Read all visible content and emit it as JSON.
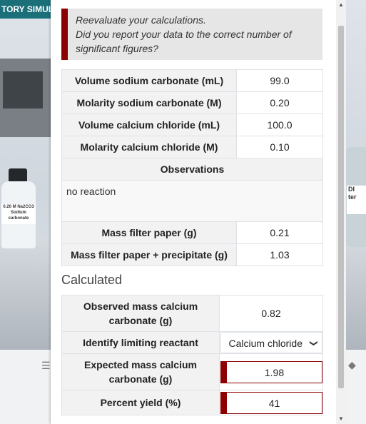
{
  "background": {
    "app_title": "TORY SIMUL",
    "bottle_label": [
      "0.20 M Na2CO3",
      "Sodium carbonate"
    ],
    "bottle2_label": [
      "DI",
      "ter"
    ]
  },
  "alert": {
    "line1": "Reevaluate your calculations.",
    "line2": "Did you report your data to the correct number of",
    "line3": "significant figures?"
  },
  "data_table": {
    "rows": [
      {
        "label": "Volume sodium carbonate (mL)",
        "value": "99.0"
      },
      {
        "label": "Molarity sodium carbonate (M)",
        "value": "0.20"
      },
      {
        "label": "Volume calcium chloride (mL)",
        "value": "100.0"
      },
      {
        "label": "Molarity calcium chloride (M)",
        "value": "0.10"
      }
    ],
    "observations_header": "Observations",
    "observations_text": "no reaction",
    "mass_rows": [
      {
        "label": "Mass filter paper (g)",
        "value": "0.21"
      },
      {
        "label": "Mass filter paper + precipitate (g)",
        "value": "1.03"
      }
    ]
  },
  "calculated": {
    "title": "Calculated",
    "observed_mass": {
      "label": "Observed mass calcium carbonate (g)",
      "value": "0.82"
    },
    "limiting_reactant": {
      "label": "Identify limiting reactant",
      "selected": "Calcium chloride"
    },
    "expected_mass": {
      "label": "Expected mass calcium carbonate (g)",
      "value": "1.98"
    },
    "percent_yield": {
      "label": "Percent yield (%)",
      "value": "41"
    }
  },
  "colors": {
    "alert_accent": "#8b0000",
    "header_teal": "#1b6f79"
  }
}
